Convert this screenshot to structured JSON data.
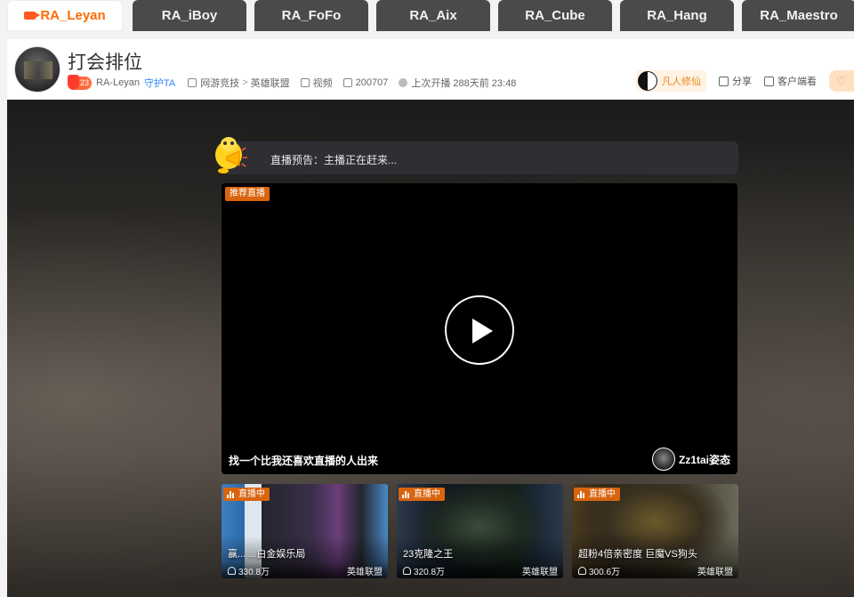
{
  "tabs": [
    {
      "label": "RA_Leyan",
      "active": true
    },
    {
      "label": "RA_iBoy"
    },
    {
      "label": "RA_FoFo"
    },
    {
      "label": "RA_Aix"
    },
    {
      "label": "RA_Cube"
    },
    {
      "label": "RA_Hang"
    },
    {
      "label": "RA_Maestro"
    }
  ],
  "header": {
    "title": "打会排位",
    "badge_level": "23",
    "anchor": "RA-Leyan",
    "guard": "守护TA",
    "category": "网游竞技",
    "category_sep": ">",
    "game": "英雄联盟",
    "video": "视频",
    "room_id": "200707",
    "last_live": "上次开播 288天前 23:48",
    "fanren": "凡人修仙",
    "share": "分享",
    "client_watch": "客户端看"
  },
  "notice": {
    "text": "直播预告：主播正在赶来..."
  },
  "player": {
    "tag": "推荐直播",
    "title": "找一个比我还喜欢直播的人出来",
    "streamer": "Zz1tai姿态"
  },
  "cards": [
    {
      "tag": "直播中",
      "title": "赢...  ...白金娱乐局",
      "viewers": "330.8万",
      "game": "英雄联盟",
      "bg": "c1"
    },
    {
      "tag": "直播中",
      "title": "23克隆之王",
      "viewers": "320.8万",
      "game": "英雄联盟",
      "bg": "c2"
    },
    {
      "tag": "直播中",
      "title": "超粉4倍亲密度 巨魔VS狗头",
      "viewers": "300.6万",
      "game": "英雄联盟",
      "bg": "c3"
    }
  ],
  "colors": {
    "accent": "#ff6a00",
    "tag_orange": "#d9640e",
    "guard_blue": "#2f86ff"
  }
}
